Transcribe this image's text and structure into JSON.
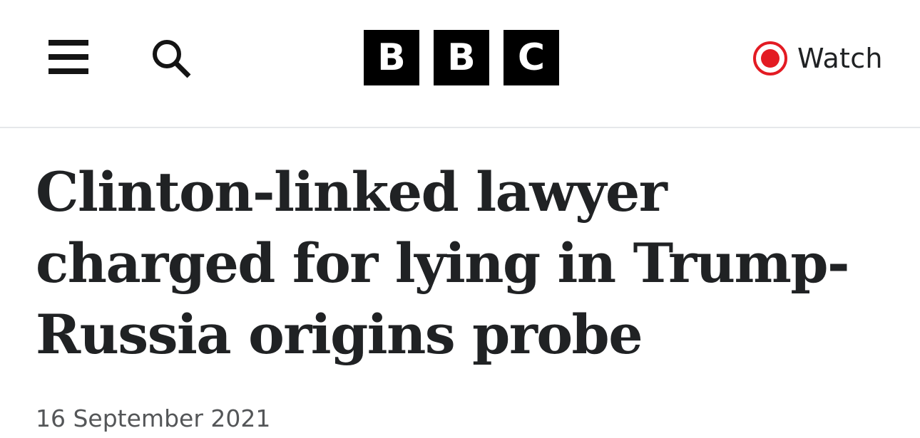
{
  "header": {
    "menu_icon": "hamburger-menu-icon",
    "search_icon": "search-icon",
    "logo": [
      "B",
      "B",
      "C"
    ],
    "watch_label": "Watch",
    "watch_icon": "live-record-icon",
    "accent_color": "#e31b23",
    "border_color": "#e6e8ea"
  },
  "article": {
    "headline": "Clinton-linked lawyer charged for lying in Trump-Russia origins probe",
    "date": "16 September 2021"
  }
}
